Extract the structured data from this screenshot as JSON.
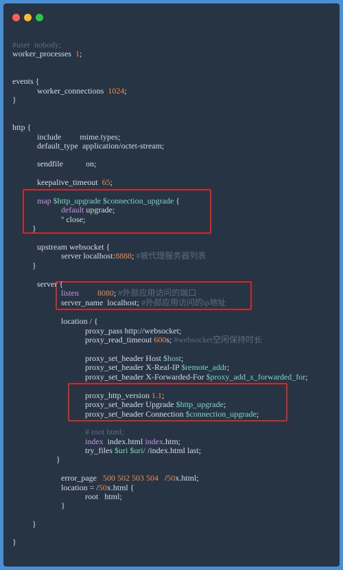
{
  "window": {
    "controls": [
      {
        "name": "close",
        "color": "#ff5f57"
      },
      {
        "name": "minimize",
        "color": "#febc2e"
      },
      {
        "name": "maximize",
        "color": "#28c840"
      }
    ]
  },
  "code_lines": [
    [
      {
        "t": "#user  nobody;",
        "c": "c"
      }
    ],
    [
      {
        "t": "worker_processes  "
      },
      {
        "t": "1",
        "c": "n"
      },
      {
        "t": ";"
      }
    ],
    [
      {
        "t": "events {"
      }
    ],
    [
      {
        "t": "worker_connections  "
      },
      {
        "t": "1024",
        "c": "n"
      },
      {
        "t": ";"
      }
    ],
    [
      {
        "t": "}"
      }
    ],
    [
      {
        "t": "http {"
      }
    ],
    [
      {
        "t": "include         mime.types;"
      }
    ],
    [
      {
        "t": "default_type  application/octet-stream;"
      }
    ],
    [
      {
        "t": "sendfile           on;"
      }
    ],
    [
      {
        "t": "keepalive_timeout  "
      },
      {
        "t": "65",
        "c": "n"
      },
      {
        "t": ";"
      }
    ],
    [
      {
        "t": "map ",
        "c": "k"
      },
      {
        "t": "$http_upgrade $connection_upgrade",
        "c": "v"
      },
      {
        "t": " {"
      }
    ],
    [
      {
        "t": "default",
        "c": "k"
      },
      {
        "t": " upgrade;"
      }
    ],
    [
      {
        "t": "'' close;"
      }
    ],
    [
      {
        "t": "}"
      }
    ],
    [
      {
        "t": "upstream websocket {"
      }
    ],
    [
      {
        "t": "server localhost:"
      },
      {
        "t": "8888",
        "c": "n"
      },
      {
        "t": "; "
      },
      {
        "t": "#被代理服务器列表",
        "c": "c"
      }
    ],
    [
      {
        "t": "}"
      }
    ],
    [
      {
        "t": "server {"
      }
    ],
    [
      {
        "t": "listen",
        "c": "k"
      },
      {
        "t": "         "
      },
      {
        "t": "8080",
        "c": "n"
      },
      {
        "t": "; "
      },
      {
        "t": "#外部应用访问的端口",
        "c": "c"
      }
    ],
    [
      {
        "t": "server_name  localhost; "
      },
      {
        "t": "#外部应用访问的ip地址",
        "c": "c"
      }
    ],
    [
      {
        "t": "location / {"
      }
    ],
    [
      {
        "t": "proxy_pass http://websocket;"
      }
    ],
    [
      {
        "t": "proxy_read_timeout "
      },
      {
        "t": "600",
        "c": "n"
      },
      {
        "t": "s; "
      },
      {
        "t": "#websocket空闲保持时长",
        "c": "c"
      }
    ],
    [
      {
        "t": "proxy_set_header Host "
      },
      {
        "t": "$host",
        "c": "v"
      },
      {
        "t": ";"
      }
    ],
    [
      {
        "t": "proxy_set_header X-Real-IP "
      },
      {
        "t": "$remote_addr",
        "c": "v"
      },
      {
        "t": ";"
      }
    ],
    [
      {
        "t": "proxy_set_header X-Forwarded-For "
      },
      {
        "t": "$proxy_add_x_forwarded_for",
        "c": "v"
      },
      {
        "t": ";"
      }
    ],
    [
      {
        "t": "proxy_http_version "
      },
      {
        "t": "1.1",
        "c": "n"
      },
      {
        "t": ";"
      }
    ],
    [
      {
        "t": "proxy_set_header Upgrade "
      },
      {
        "t": "$http_upgrade",
        "c": "v"
      },
      {
        "t": ";"
      }
    ],
    [
      {
        "t": "proxy_set_header Connection "
      },
      {
        "t": "$connection_upgrade",
        "c": "v"
      },
      {
        "t": ";"
      }
    ],
    [
      {
        "t": "# root html;",
        "c": "c"
      }
    ],
    [
      {
        "t": "index",
        "c": "k"
      },
      {
        "t": "  index.html "
      },
      {
        "t": "index",
        "c": "k"
      },
      {
        "t": ".htm;"
      }
    ],
    [
      {
        "t": "try_files "
      },
      {
        "t": "$uri $uri/",
        "c": "v"
      },
      {
        "t": " /index.html last;"
      }
    ],
    [
      {
        "t": "}"
      }
    ],
    [
      {
        "t": "error_page   "
      },
      {
        "t": "500 502 503 504",
        "c": "n"
      },
      {
        "t": "   /"
      },
      {
        "t": "50",
        "c": "n"
      },
      {
        "t": "x.html;"
      }
    ],
    [
      {
        "t": "location = /"
      },
      {
        "t": "50",
        "c": "n"
      },
      {
        "t": "x.html {"
      }
    ],
    [
      {
        "t": "root   html;"
      }
    ],
    [
      {
        "t": "}"
      }
    ],
    [
      {
        "t": "}"
      }
    ],
    [
      {
        "t": "}"
      }
    ]
  ]
}
